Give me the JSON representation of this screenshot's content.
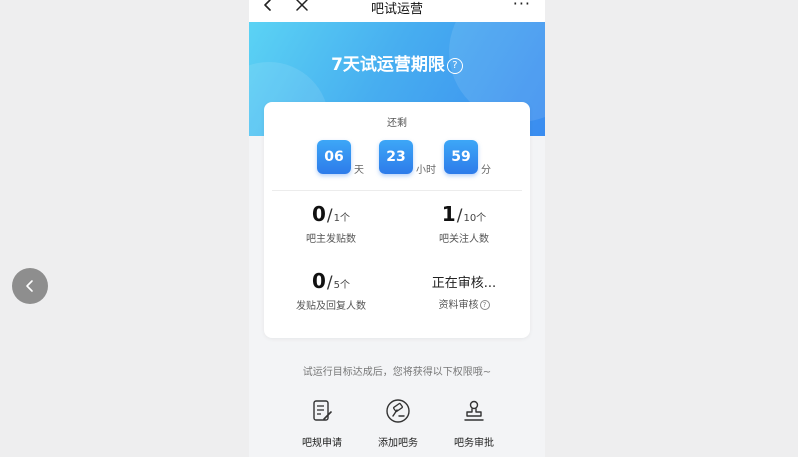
{
  "navbar": {
    "title": "吧试运营",
    "more": "···"
  },
  "hero": {
    "title": "7天试运营期限",
    "help_icon": "?"
  },
  "countdown": {
    "label": "还剩",
    "days": "06",
    "days_unit": "天",
    "hours": "23",
    "hours_unit": "小时",
    "minutes": "59",
    "minutes_unit": "分"
  },
  "stats": [
    {
      "value": "0",
      "total": "1个",
      "label": "吧主发贴数"
    },
    {
      "value": "1",
      "total": "10个",
      "label": "吧关注人数"
    },
    {
      "value": "0",
      "total": "5个",
      "label": "发贴及回复人数"
    },
    {
      "status": "正在审核...",
      "label": "资料审核",
      "help_icon": "?"
    }
  ],
  "hint": "试运行目标达成后，您将获得以下权限哦~",
  "permissions": [
    {
      "label": "吧规申请",
      "icon": "document-edit-icon"
    },
    {
      "label": "添加吧务",
      "icon": "gavel-icon"
    },
    {
      "label": "吧务审批",
      "icon": "stamp-icon"
    }
  ],
  "colors": {
    "accent": "#2d7bea",
    "hero_start": "#5bd3f4",
    "hero_end": "#3a8cf0"
  }
}
